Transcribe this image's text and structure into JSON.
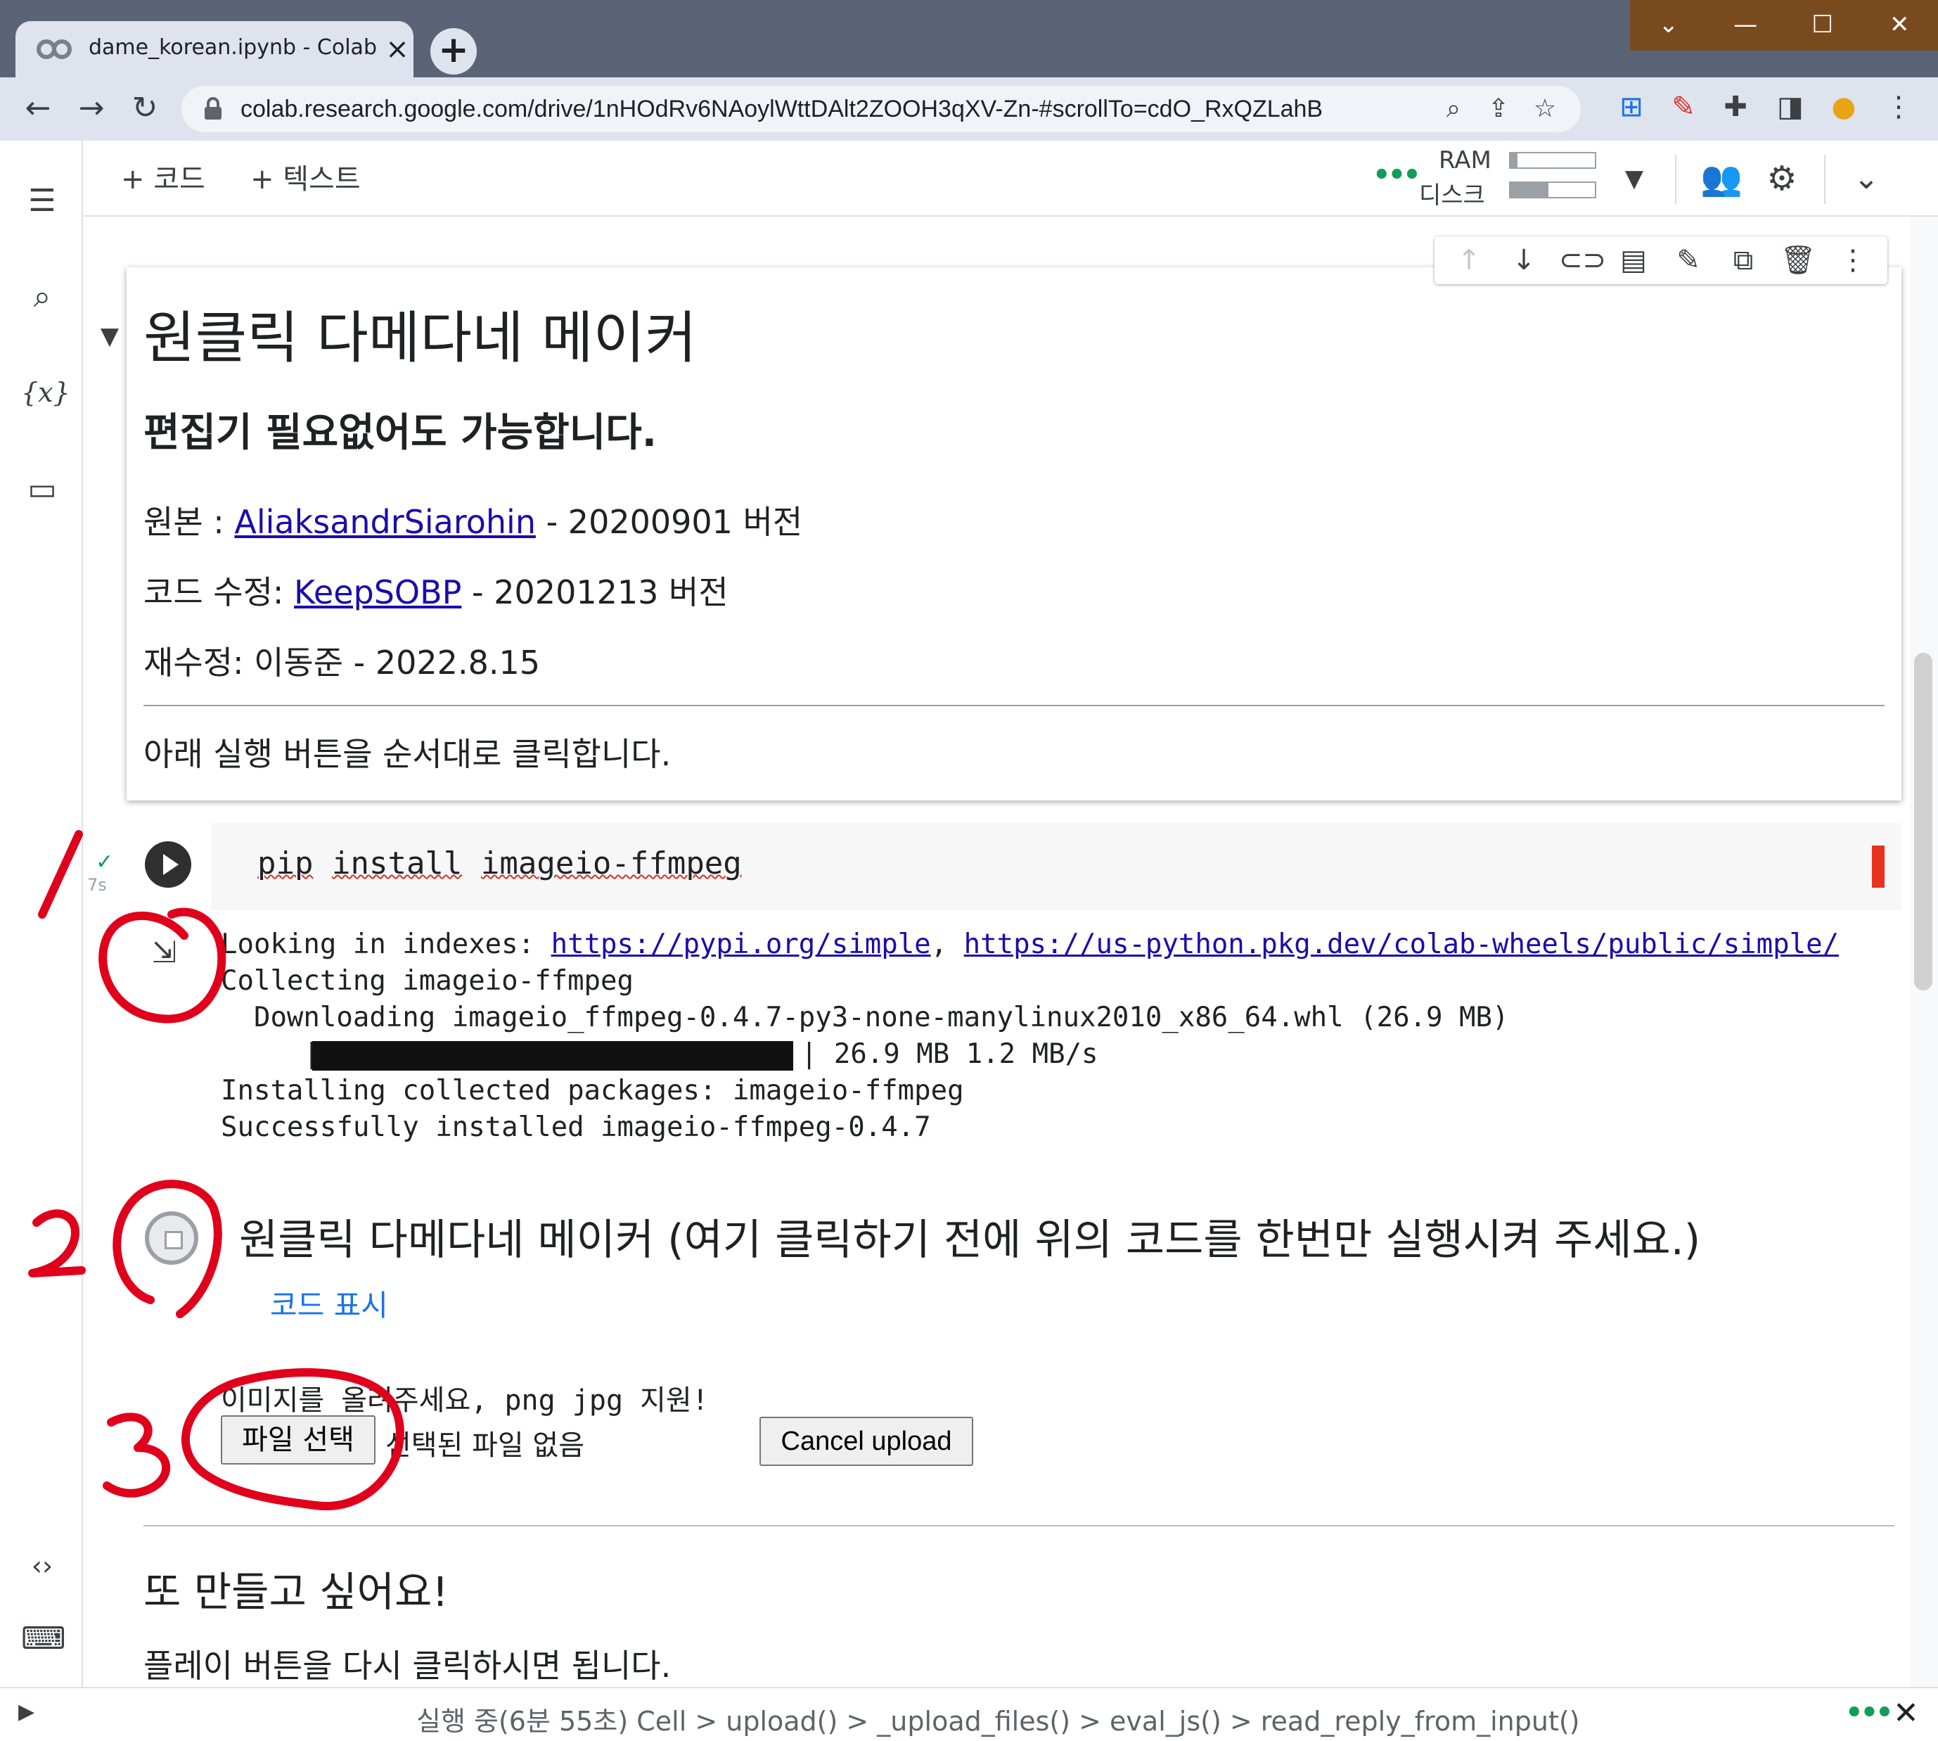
{
  "browser": {
    "tab_title": "dame_korean.ipynb - Colaboratory",
    "tab_close": "×",
    "new_tab": "+",
    "window_controls": [
      "⌄",
      "—",
      "☐",
      "✕"
    ],
    "url": "colab.research.google.com/drive/1nHOdRv6NAoylWttDAlt2ZOOH3qXV-Zn-#scrollTo=cdO_RxQZLahB"
  },
  "colab_toolbar": {
    "add_code": "+ 코드",
    "add_text": "+ 텍스트",
    "ram_label": "RAM",
    "disk_label": "디스크",
    "ram_usage": 0.08,
    "disk_usage": 0.45
  },
  "text_cell": {
    "title": "원클릭 다메다네 메이커",
    "subtitle": "편집기 필요없어도 가능합니다.",
    "original_prefix": "원본 : ",
    "original_author": "AliaksandrSiarohin",
    "original_suffix": " - 20200901 버전",
    "modified_prefix": "코드 수정: ",
    "modified_author": "KeepSOBP",
    "modified_suffix": " - 20201213 버전",
    "revised_line": "재수정: 이동준 - 2022.8.15",
    "instruction": "아래 실행 버튼을 순서대로 클릭합니다."
  },
  "code_cell": {
    "code_pip": "pip",
    "code_install": "install",
    "code_pkg": "imageio-ffmpeg",
    "exec_count": "7s",
    "output": {
      "line1_prefix": "Looking in indexes: ",
      "line1_link1": "https://pypi.org/simple",
      "line1_sep": ", ",
      "line1_link2": "https://us-python.pkg.dev/colab-wheels/public/simple/",
      "line2": "Collecting imageio-ffmpeg",
      "line3": "  Downloading imageio_ffmpeg-0.4.7-py3-none-manylinux2010_x86_64.whl (26.9 MB)",
      "line4_prefix": "     |",
      "line4_suffix": "| 26.9 MB 1.2 MB/s",
      "line5": "Installing collected packages: imageio-ffmpeg",
      "line6": "Successfully installed imageio-ffmpeg-0.4.7"
    }
  },
  "form_cell": {
    "title": "원클릭 다메다네 메이커 (여기 클릭하기 전에 위의 코드를 한번만 실행시켜 주세요.)",
    "show_code": "코드 표시",
    "upload_prompt": "이미지를 올려주세요, png jpg 지원!",
    "file_button": "파일 선택",
    "file_status": "선택된 파일 없음",
    "cancel_button": "Cancel upload"
  },
  "bottom": {
    "heading": "또 만들고 싶어요!",
    "text": "플레이 버튼을 다시 클릭하시면 됩니다."
  },
  "status_bar": {
    "text": "실행 중(6분 55초)  Cell > upload() > _upload_files() > eval_js() > read_reply_from_input()"
  },
  "annotations": {
    "labels": [
      "1",
      "2",
      "3"
    ],
    "color": "#e0001b"
  },
  "colors": {
    "chrome_title": "#5b6377",
    "chrome_toolbar": "#dfe3ee",
    "link": "#1a0dab",
    "accent_blue": "#1a73e8",
    "status_green": "#0f9d58",
    "exec_red": "#e8321e"
  }
}
